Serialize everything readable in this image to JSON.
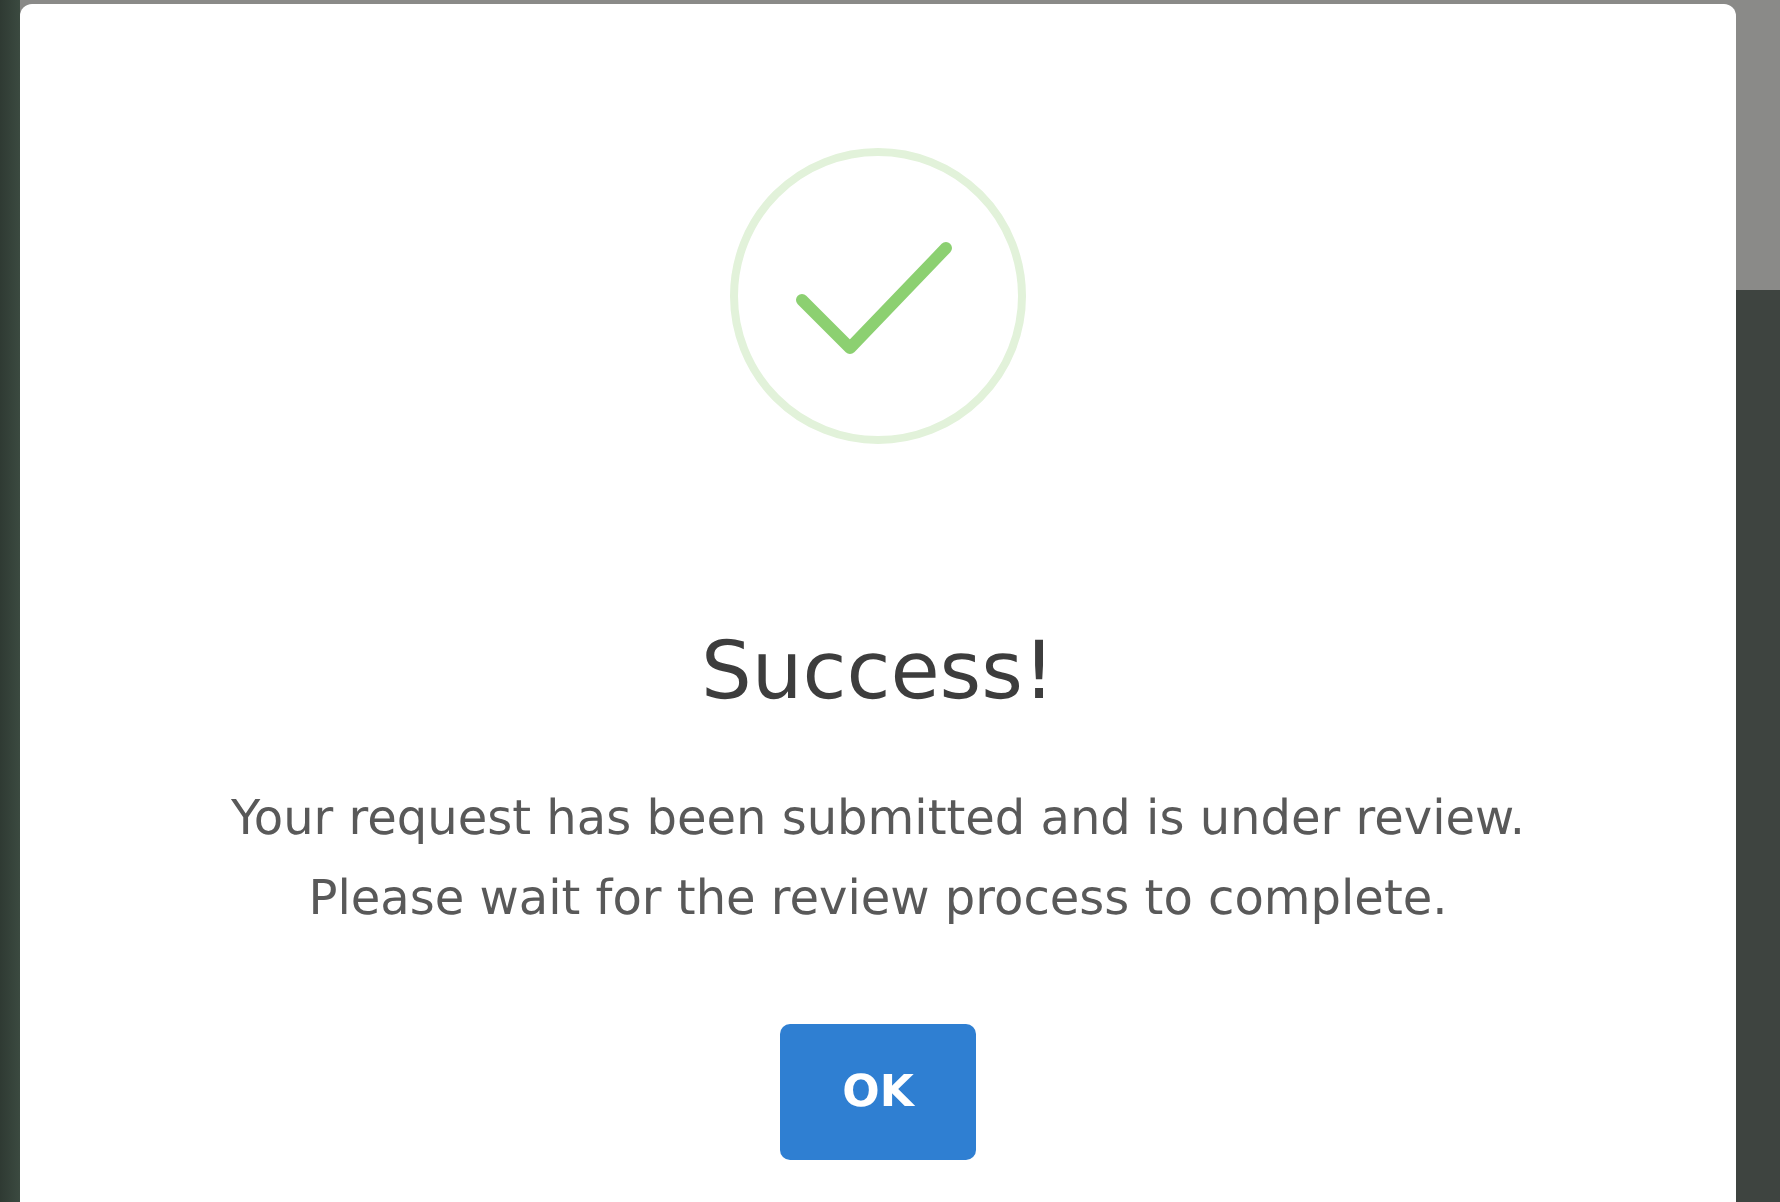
{
  "dialog": {
    "kind": "success",
    "title": "Success!",
    "message": [
      "Your request has been submitted and is under review.",
      "Please wait for the review process to complete."
    ],
    "buttons": [
      {
        "label": "OK"
      }
    ]
  }
}
